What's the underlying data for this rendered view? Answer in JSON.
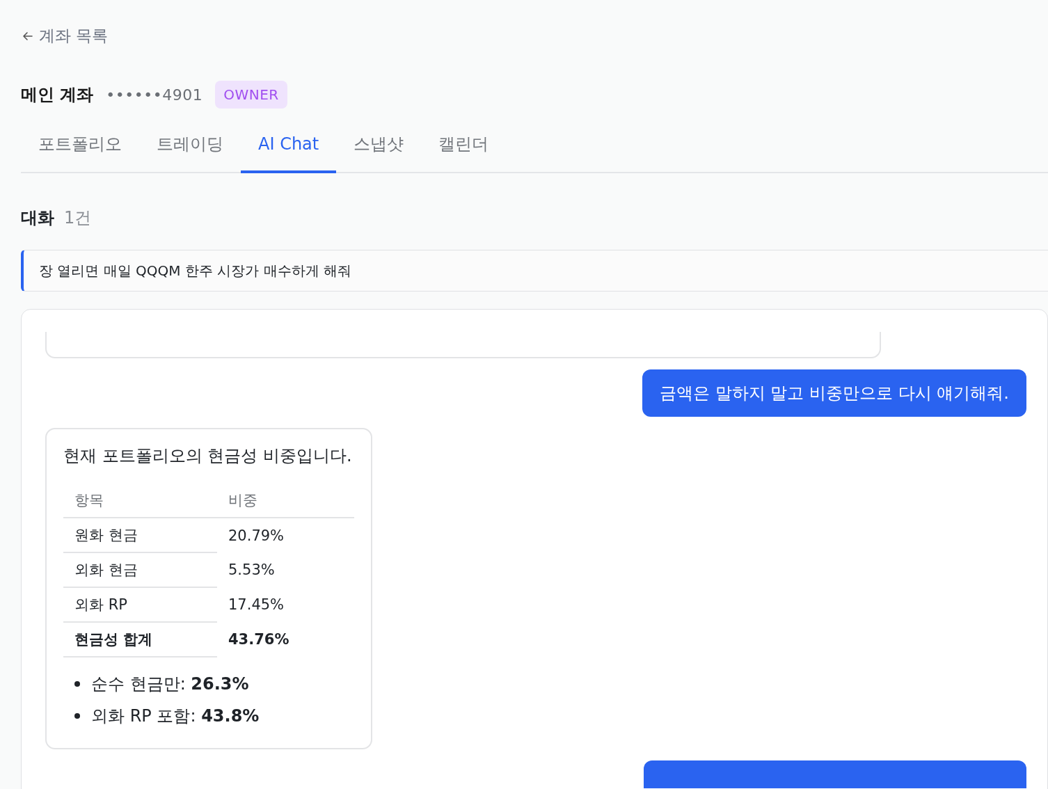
{
  "back_link": {
    "label": "계좌 목록"
  },
  "account": {
    "name": "메인 계좌",
    "number": "••••••4901",
    "role": "OWNER"
  },
  "tabs": [
    {
      "label": "포트폴리오",
      "selected": false
    },
    {
      "label": "트레이딩",
      "selected": false
    },
    {
      "label": "AI Chat",
      "selected": true
    },
    {
      "label": "스냅샷",
      "selected": false
    },
    {
      "label": "캘린더",
      "selected": false
    }
  ],
  "conversations": {
    "title": "대화",
    "count": "1건",
    "items": [
      {
        "text": "장 열리면 매일 QQQM 한주 시장가 매수하게 해줘",
        "selected": true
      }
    ]
  },
  "messages": [
    {
      "kind": "assistant_cut"
    },
    {
      "kind": "user",
      "text": "금액은 말하지 말고 비중만으로 다시 얘기해줘."
    },
    {
      "kind": "assistant",
      "text": "현재 포트폴리오의 현금성 비중입니다.",
      "table": {
        "columns": [
          "항목",
          "비중"
        ],
        "rows": [
          {
            "cells": [
              "원화 현금",
              "20.79%"
            ],
            "bold": false
          },
          {
            "cells": [
              "외화 현금",
              "5.53%"
            ],
            "bold": false
          },
          {
            "cells": [
              "외화 RP",
              "17.45%"
            ],
            "bold": false
          },
          {
            "cells": [
              "현금성 합계",
              "43.76%"
            ],
            "bold": true
          }
        ]
      },
      "bullets": [
        "순수 현금만: **26.3%**",
        "외화 RP 포함: **43.8%**"
      ]
    },
    {
      "kind": "user_cut"
    }
  ]
}
